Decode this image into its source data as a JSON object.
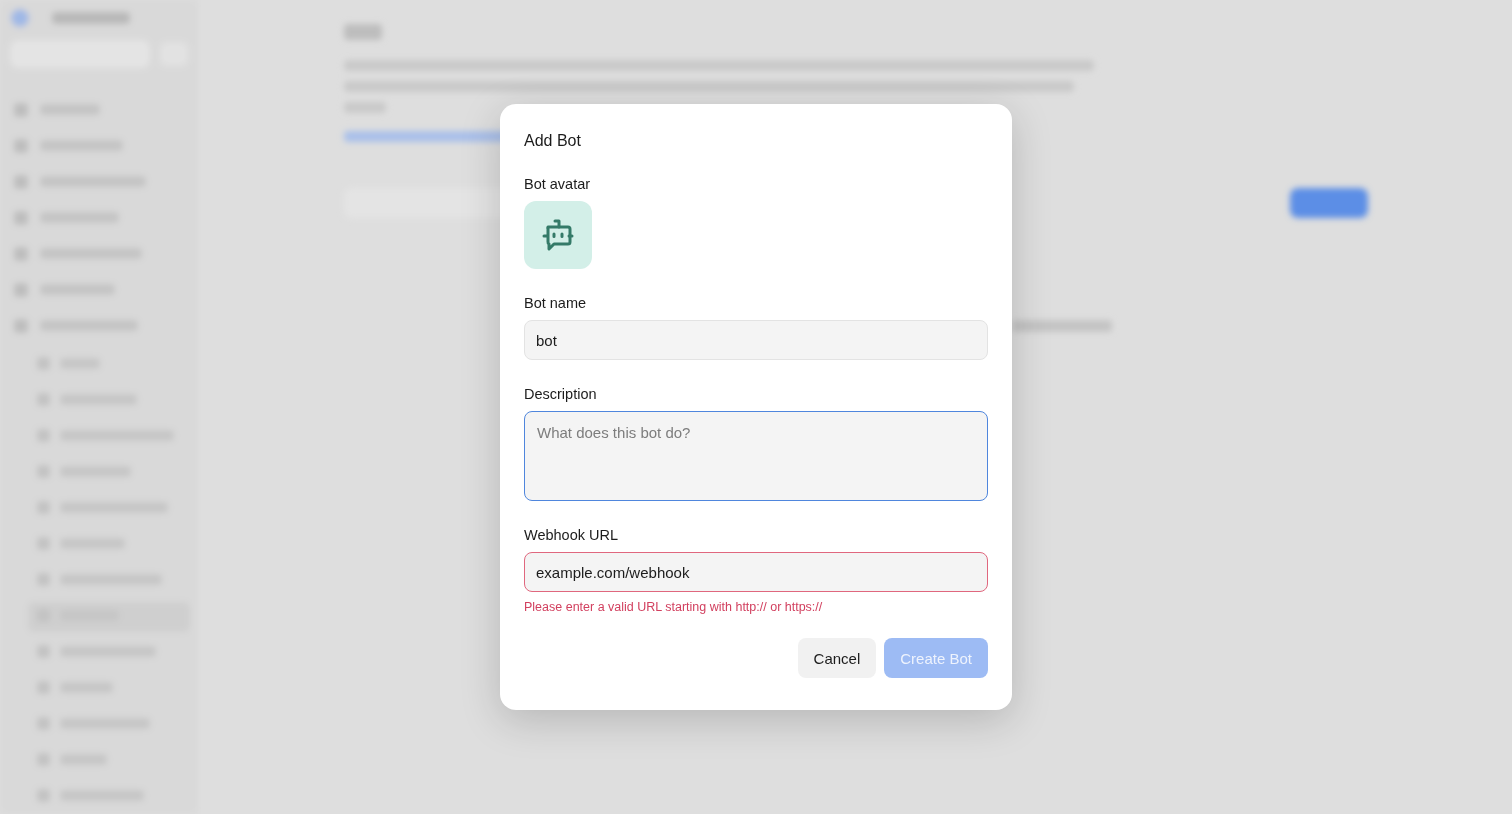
{
  "dialog": {
    "title": "Add Bot",
    "avatar": {
      "label": "Bot avatar"
    },
    "fields": [
      {
        "kind": "input",
        "label": "Bot name",
        "value": "bot",
        "focused": false,
        "invalid": false
      },
      {
        "kind": "textarea",
        "label": "Description",
        "placeholder": "What does this bot do?",
        "focused": true,
        "invalid": false
      },
      {
        "kind": "input",
        "label": "Webhook URL",
        "value": "example.com/webhook",
        "focused": false,
        "invalid": true,
        "error": "Please enter a valid URL starting with http:// or https://"
      }
    ],
    "buttons": [
      {
        "label": "Cancel",
        "kind": "secondary",
        "disabled": false
      },
      {
        "label": "Create Bot",
        "kind": "primary",
        "disabled": true
      }
    ]
  }
}
